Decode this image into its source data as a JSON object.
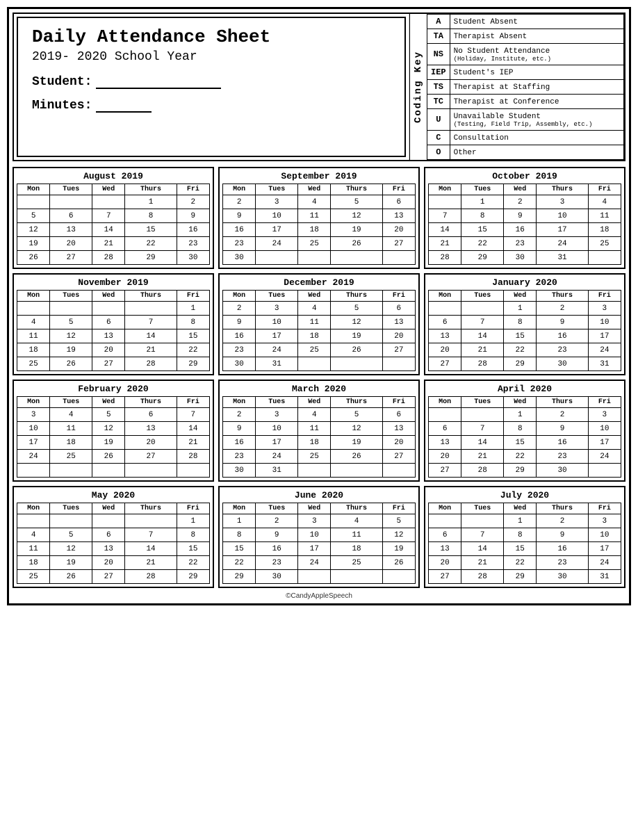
{
  "header": {
    "title": "Daily Attendance Sheet",
    "year": "2019- 2020 School Year",
    "student_label": "Student:",
    "minutes_label": "Minutes:"
  },
  "coding_key": {
    "label": "Coding Key",
    "entries": [
      {
        "code": "A",
        "desc": "Student Absent",
        "sub": ""
      },
      {
        "code": "TA",
        "desc": "Therapist Absent",
        "sub": ""
      },
      {
        "code": "NS",
        "desc": "No Student Attendance",
        "sub": "(Holiday, Institute, etc.)"
      },
      {
        "code": "IEP",
        "desc": "Student's IEP",
        "sub": ""
      },
      {
        "code": "TS",
        "desc": "Therapist at Staffing",
        "sub": ""
      },
      {
        "code": "TC",
        "desc": "Therapist at Conference",
        "sub": ""
      },
      {
        "code": "U",
        "desc": "Unavailable Student",
        "sub": "(Testing, Field Trip, Assembly, etc.)"
      },
      {
        "code": "C",
        "desc": "Consultation",
        "sub": ""
      },
      {
        "code": "O",
        "desc": "Other",
        "sub": ""
      }
    ]
  },
  "calendars": [
    {
      "name": "August 2019",
      "days": [
        [
          "",
          "",
          "",
          "1",
          "2"
        ],
        [
          "5",
          "6",
          "7",
          "8",
          "9"
        ],
        [
          "12",
          "13",
          "14",
          "15",
          "16"
        ],
        [
          "19",
          "20",
          "21",
          "22",
          "23"
        ],
        [
          "26",
          "27",
          "28",
          "29",
          "30"
        ]
      ]
    },
    {
      "name": "September 2019",
      "days": [
        [
          "2",
          "3",
          "4",
          "5",
          "6"
        ],
        [
          "9",
          "10",
          "11",
          "12",
          "13"
        ],
        [
          "16",
          "17",
          "18",
          "19",
          "20"
        ],
        [
          "23",
          "24",
          "25",
          "26",
          "27"
        ],
        [
          "30",
          "",
          "",
          "",
          ""
        ]
      ]
    },
    {
      "name": "October 2019",
      "days": [
        [
          "",
          "1",
          "2",
          "3",
          "4"
        ],
        [
          "7",
          "8",
          "9",
          "10",
          "11"
        ],
        [
          "14",
          "15",
          "16",
          "17",
          "18"
        ],
        [
          "21",
          "22",
          "23",
          "24",
          "25"
        ],
        [
          "28",
          "29",
          "30",
          "31",
          ""
        ]
      ]
    },
    {
      "name": "November 2019",
      "days": [
        [
          "",
          "",
          "",
          "",
          "1"
        ],
        [
          "4",
          "5",
          "6",
          "7",
          "8"
        ],
        [
          "11",
          "12",
          "13",
          "14",
          "15"
        ],
        [
          "18",
          "19",
          "20",
          "21",
          "22"
        ],
        [
          "25",
          "26",
          "27",
          "28",
          "29"
        ]
      ]
    },
    {
      "name": "December 2019",
      "days": [
        [
          "2",
          "3",
          "4",
          "5",
          "6"
        ],
        [
          "9",
          "10",
          "11",
          "12",
          "13"
        ],
        [
          "16",
          "17",
          "18",
          "19",
          "20"
        ],
        [
          "23",
          "24",
          "25",
          "26",
          "27"
        ],
        [
          "30",
          "31",
          "",
          "",
          ""
        ]
      ]
    },
    {
      "name": "January 2020",
      "days": [
        [
          "",
          "",
          "1",
          "2",
          "3"
        ],
        [
          "6",
          "7",
          "8",
          "9",
          "10"
        ],
        [
          "13",
          "14",
          "15",
          "16",
          "17"
        ],
        [
          "20",
          "21",
          "22",
          "23",
          "24"
        ],
        [
          "27",
          "28",
          "29",
          "30",
          "31"
        ]
      ]
    },
    {
      "name": "February 2020",
      "days": [
        [
          "3",
          "4",
          "5",
          "6",
          "7"
        ],
        [
          "10",
          "11",
          "12",
          "13",
          "14"
        ],
        [
          "17",
          "18",
          "19",
          "20",
          "21"
        ],
        [
          "24",
          "25",
          "26",
          "27",
          "28"
        ],
        [
          "",
          "",
          "",
          "",
          ""
        ]
      ]
    },
    {
      "name": "March 2020",
      "days": [
        [
          "2",
          "3",
          "4",
          "5",
          "6"
        ],
        [
          "9",
          "10",
          "11",
          "12",
          "13"
        ],
        [
          "16",
          "17",
          "18",
          "19",
          "20"
        ],
        [
          "23",
          "24",
          "25",
          "26",
          "27"
        ],
        [
          "30",
          "31",
          "",
          "",
          ""
        ]
      ]
    },
    {
      "name": "April 2020",
      "days": [
        [
          "",
          "",
          "1",
          "2",
          "3"
        ],
        [
          "6",
          "7",
          "8",
          "9",
          "10"
        ],
        [
          "13",
          "14",
          "15",
          "16",
          "17"
        ],
        [
          "20",
          "21",
          "22",
          "23",
          "24"
        ],
        [
          "27",
          "28",
          "29",
          "30",
          ""
        ]
      ]
    },
    {
      "name": "May 2020",
      "days": [
        [
          "",
          "",
          "",
          "",
          "1"
        ],
        [
          "4",
          "5",
          "6",
          "7",
          "8"
        ],
        [
          "11",
          "12",
          "13",
          "14",
          "15"
        ],
        [
          "18",
          "19",
          "20",
          "21",
          "22"
        ],
        [
          "25",
          "26",
          "27",
          "28",
          "29"
        ]
      ]
    },
    {
      "name": "June 2020",
      "days": [
        [
          "1",
          "2",
          "3",
          "4",
          "5"
        ],
        [
          "8",
          "9",
          "10",
          "11",
          "12"
        ],
        [
          "15",
          "16",
          "17",
          "18",
          "19"
        ],
        [
          "22",
          "23",
          "24",
          "25",
          "26"
        ],
        [
          "29",
          "30",
          "",
          "",
          ""
        ]
      ]
    },
    {
      "name": "July 2020",
      "days": [
        [
          "",
          "",
          "1",
          "2",
          "3"
        ],
        [
          "6",
          "7",
          "8",
          "9",
          "10"
        ],
        [
          "13",
          "14",
          "15",
          "16",
          "17"
        ],
        [
          "20",
          "21",
          "22",
          "23",
          "24"
        ],
        [
          "27",
          "28",
          "29",
          "30",
          "31"
        ]
      ]
    }
  ],
  "days_of_week": [
    "Mon",
    "Tues",
    "Wed",
    "Thurs",
    "Fri"
  ],
  "footer": "©CandyAppleSpeech"
}
